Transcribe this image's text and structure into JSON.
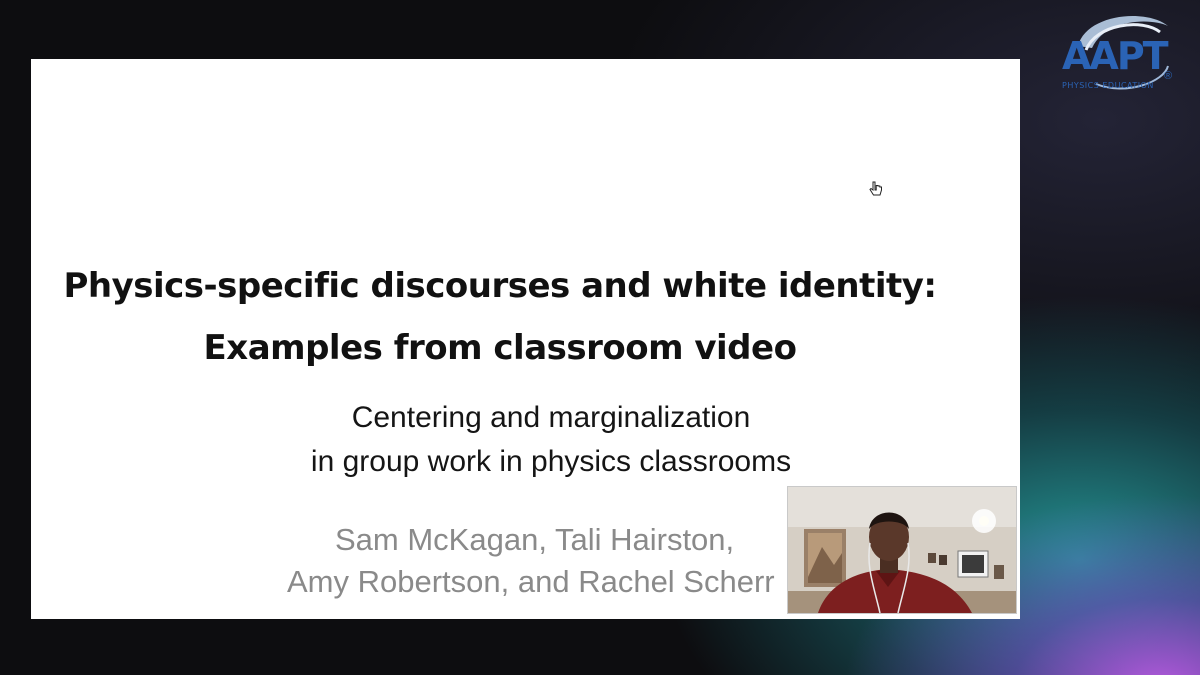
{
  "logo": {
    "name": "AAPT",
    "tagline": "PHYSICS EDUCATION",
    "registered": "®"
  },
  "slide": {
    "title_lines": [
      "Physics-specific discourses and white identity:",
      "Examples from classroom video"
    ],
    "subtitle_lines": [
      "Centering and marginalization",
      "in group work in physics classrooms"
    ],
    "author_lines": [
      "Sam McKagan, Tali Hairston,",
      "Amy Robertson, and Rachel Scherr"
    ]
  },
  "icons": {
    "cursor": "hand-pointer-icon"
  },
  "colors": {
    "logo_blue": "#2a63b5",
    "slide_bg": "#ffffff",
    "title_text": "#111111",
    "author_text": "#8a8a8a",
    "shirt_red": "#7d1f1f"
  }
}
